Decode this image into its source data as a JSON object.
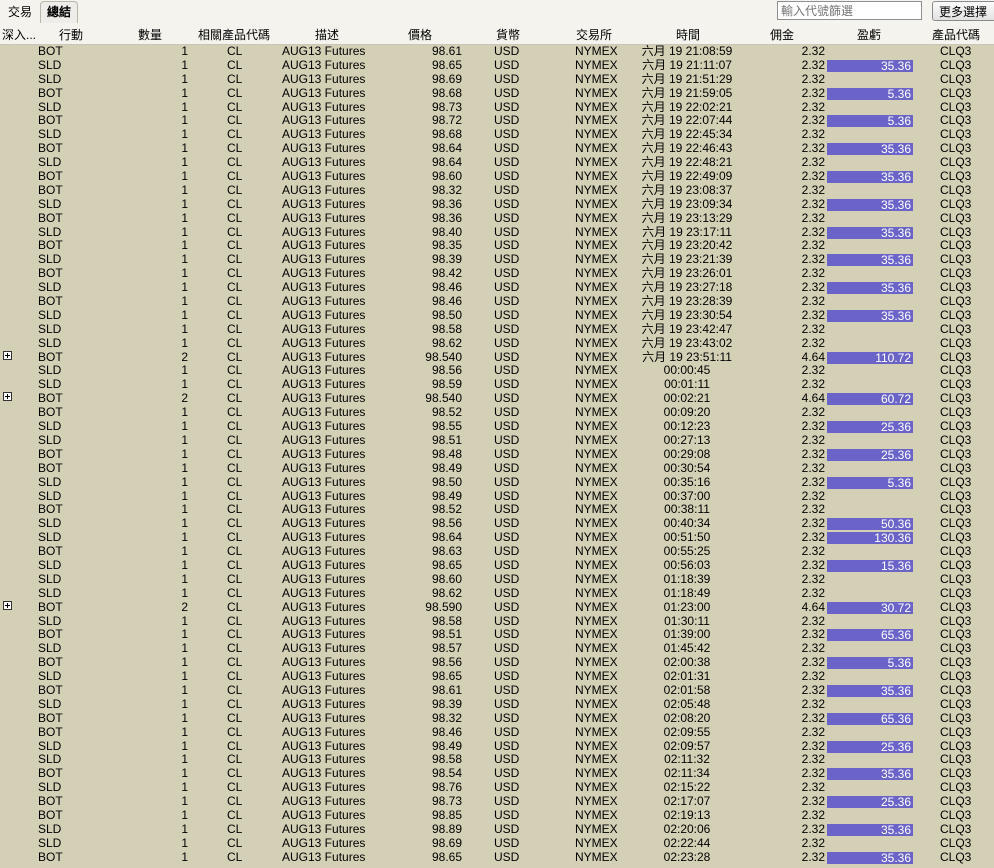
{
  "tabs": [
    {
      "label": "交易"
    },
    {
      "label": "總結"
    }
  ],
  "filter": {
    "placeholder": "輸入代號篩選"
  },
  "more_button": {
    "label": "更多選擇"
  },
  "columns": {
    "drill": "深入...",
    "action": "行動",
    "quantity": "數量",
    "underlying": "相關產品代碼",
    "description": "描述",
    "price": "價格",
    "currency": "貨幣",
    "exchange": "交易所",
    "time": "時間",
    "commission": "佣金",
    "pnl": "盈虧",
    "symbol": "產品代碼"
  },
  "colors": {
    "pnl_bar": "#6b64c8",
    "background": "#d4d0b6"
  },
  "rows": [
    {
      "action": "BOT",
      "qty": "1",
      "und": "CL",
      "desc": "AUG13 Futures",
      "price": "98.61",
      "cur": "USD",
      "exch": "NYMEX",
      "time": "六月 19 21:08:59",
      "comm": "2.32",
      "pnl": "",
      "sym": "CLQ3",
      "expand": false
    },
    {
      "action": "SLD",
      "qty": "1",
      "und": "CL",
      "desc": "AUG13 Futures",
      "price": "98.65",
      "cur": "USD",
      "exch": "NYMEX",
      "time": "六月 19 21:11:07",
      "comm": "2.32",
      "pnl": "35.36",
      "sym": "CLQ3",
      "expand": false
    },
    {
      "action": "SLD",
      "qty": "1",
      "und": "CL",
      "desc": "AUG13 Futures",
      "price": "98.69",
      "cur": "USD",
      "exch": "NYMEX",
      "time": "六月 19 21:51:29",
      "comm": "2.32",
      "pnl": "",
      "sym": "CLQ3",
      "expand": false
    },
    {
      "action": "BOT",
      "qty": "1",
      "und": "CL",
      "desc": "AUG13 Futures",
      "price": "98.68",
      "cur": "USD",
      "exch": "NYMEX",
      "time": "六月 19 21:59:05",
      "comm": "2.32",
      "pnl": "5.36",
      "sym": "CLQ3",
      "expand": false
    },
    {
      "action": "SLD",
      "qty": "1",
      "und": "CL",
      "desc": "AUG13 Futures",
      "price": "98.73",
      "cur": "USD",
      "exch": "NYMEX",
      "time": "六月 19 22:02:21",
      "comm": "2.32",
      "pnl": "",
      "sym": "CLQ3",
      "expand": false
    },
    {
      "action": "BOT",
      "qty": "1",
      "und": "CL",
      "desc": "AUG13 Futures",
      "price": "98.72",
      "cur": "USD",
      "exch": "NYMEX",
      "time": "六月 19 22:07:44",
      "comm": "2.32",
      "pnl": "5.36",
      "sym": "CLQ3",
      "expand": false
    },
    {
      "action": "SLD",
      "qty": "1",
      "und": "CL",
      "desc": "AUG13 Futures",
      "price": "98.68",
      "cur": "USD",
      "exch": "NYMEX",
      "time": "六月 19 22:45:34",
      "comm": "2.32",
      "pnl": "",
      "sym": "CLQ3",
      "expand": false
    },
    {
      "action": "BOT",
      "qty": "1",
      "und": "CL",
      "desc": "AUG13 Futures",
      "price": "98.64",
      "cur": "USD",
      "exch": "NYMEX",
      "time": "六月 19 22:46:43",
      "comm": "2.32",
      "pnl": "35.36",
      "sym": "CLQ3",
      "expand": false
    },
    {
      "action": "SLD",
      "qty": "1",
      "und": "CL",
      "desc": "AUG13 Futures",
      "price": "98.64",
      "cur": "USD",
      "exch": "NYMEX",
      "time": "六月 19 22:48:21",
      "comm": "2.32",
      "pnl": "",
      "sym": "CLQ3",
      "expand": false
    },
    {
      "action": "BOT",
      "qty": "1",
      "und": "CL",
      "desc": "AUG13 Futures",
      "price": "98.60",
      "cur": "USD",
      "exch": "NYMEX",
      "time": "六月 19 22:49:09",
      "comm": "2.32",
      "pnl": "35.36",
      "sym": "CLQ3",
      "expand": false
    },
    {
      "action": "BOT",
      "qty": "1",
      "und": "CL",
      "desc": "AUG13 Futures",
      "price": "98.32",
      "cur": "USD",
      "exch": "NYMEX",
      "time": "六月 19 23:08:37",
      "comm": "2.32",
      "pnl": "",
      "sym": "CLQ3",
      "expand": false
    },
    {
      "action": "SLD",
      "qty": "1",
      "und": "CL",
      "desc": "AUG13 Futures",
      "price": "98.36",
      "cur": "USD",
      "exch": "NYMEX",
      "time": "六月 19 23:09:34",
      "comm": "2.32",
      "pnl": "35.36",
      "sym": "CLQ3",
      "expand": false
    },
    {
      "action": "BOT",
      "qty": "1",
      "und": "CL",
      "desc": "AUG13 Futures",
      "price": "98.36",
      "cur": "USD",
      "exch": "NYMEX",
      "time": "六月 19 23:13:29",
      "comm": "2.32",
      "pnl": "",
      "sym": "CLQ3",
      "expand": false
    },
    {
      "action": "SLD",
      "qty": "1",
      "und": "CL",
      "desc": "AUG13 Futures",
      "price": "98.40",
      "cur": "USD",
      "exch": "NYMEX",
      "time": "六月 19 23:17:11",
      "comm": "2.32",
      "pnl": "35.36",
      "sym": "CLQ3",
      "expand": false
    },
    {
      "action": "BOT",
      "qty": "1",
      "und": "CL",
      "desc": "AUG13 Futures",
      "price": "98.35",
      "cur": "USD",
      "exch": "NYMEX",
      "time": "六月 19 23:20:42",
      "comm": "2.32",
      "pnl": "",
      "sym": "CLQ3",
      "expand": false
    },
    {
      "action": "SLD",
      "qty": "1",
      "und": "CL",
      "desc": "AUG13 Futures",
      "price": "98.39",
      "cur": "USD",
      "exch": "NYMEX",
      "time": "六月 19 23:21:39",
      "comm": "2.32",
      "pnl": "35.36",
      "sym": "CLQ3",
      "expand": false
    },
    {
      "action": "BOT",
      "qty": "1",
      "und": "CL",
      "desc": "AUG13 Futures",
      "price": "98.42",
      "cur": "USD",
      "exch": "NYMEX",
      "time": "六月 19 23:26:01",
      "comm": "2.32",
      "pnl": "",
      "sym": "CLQ3",
      "expand": false
    },
    {
      "action": "SLD",
      "qty": "1",
      "und": "CL",
      "desc": "AUG13 Futures",
      "price": "98.46",
      "cur": "USD",
      "exch": "NYMEX",
      "time": "六月 19 23:27:18",
      "comm": "2.32",
      "pnl": "35.36",
      "sym": "CLQ3",
      "expand": false
    },
    {
      "action": "BOT",
      "qty": "1",
      "und": "CL",
      "desc": "AUG13 Futures",
      "price": "98.46",
      "cur": "USD",
      "exch": "NYMEX",
      "time": "六月 19 23:28:39",
      "comm": "2.32",
      "pnl": "",
      "sym": "CLQ3",
      "expand": false
    },
    {
      "action": "SLD",
      "qty": "1",
      "und": "CL",
      "desc": "AUG13 Futures",
      "price": "98.50",
      "cur": "USD",
      "exch": "NYMEX",
      "time": "六月 19 23:30:54",
      "comm": "2.32",
      "pnl": "35.36",
      "sym": "CLQ3",
      "expand": false
    },
    {
      "action": "SLD",
      "qty": "1",
      "und": "CL",
      "desc": "AUG13 Futures",
      "price": "98.58",
      "cur": "USD",
      "exch": "NYMEX",
      "time": "六月 19 23:42:47",
      "comm": "2.32",
      "pnl": "",
      "sym": "CLQ3",
      "expand": false
    },
    {
      "action": "SLD",
      "qty": "1",
      "und": "CL",
      "desc": "AUG13 Futures",
      "price": "98.62",
      "cur": "USD",
      "exch": "NYMEX",
      "time": "六月 19 23:43:02",
      "comm": "2.32",
      "pnl": "",
      "sym": "CLQ3",
      "expand": false
    },
    {
      "action": "BOT",
      "qty": "2",
      "und": "CL",
      "desc": "AUG13 Futures",
      "price": "98.540",
      "cur": "USD",
      "exch": "NYMEX",
      "time": "六月 19 23:51:11",
      "comm": "4.64",
      "pnl": "110.72",
      "sym": "CLQ3",
      "expand": true
    },
    {
      "action": "SLD",
      "qty": "1",
      "und": "CL",
      "desc": "AUG13 Futures",
      "price": "98.56",
      "cur": "USD",
      "exch": "NYMEX",
      "time": "00:00:45",
      "comm": "2.32",
      "pnl": "",
      "sym": "CLQ3",
      "expand": false
    },
    {
      "action": "SLD",
      "qty": "1",
      "und": "CL",
      "desc": "AUG13 Futures",
      "price": "98.59",
      "cur": "USD",
      "exch": "NYMEX",
      "time": "00:01:11",
      "comm": "2.32",
      "pnl": "",
      "sym": "CLQ3",
      "expand": false
    },
    {
      "action": "BOT",
      "qty": "2",
      "und": "CL",
      "desc": "AUG13 Futures",
      "price": "98.540",
      "cur": "USD",
      "exch": "NYMEX",
      "time": "00:02:21",
      "comm": "4.64",
      "pnl": "60.72",
      "sym": "CLQ3",
      "expand": true
    },
    {
      "action": "BOT",
      "qty": "1",
      "und": "CL",
      "desc": "AUG13 Futures",
      "price": "98.52",
      "cur": "USD",
      "exch": "NYMEX",
      "time": "00:09:20",
      "comm": "2.32",
      "pnl": "",
      "sym": "CLQ3",
      "expand": false
    },
    {
      "action": "SLD",
      "qty": "1",
      "und": "CL",
      "desc": "AUG13 Futures",
      "price": "98.55",
      "cur": "USD",
      "exch": "NYMEX",
      "time": "00:12:23",
      "comm": "2.32",
      "pnl": "25.36",
      "sym": "CLQ3",
      "expand": false
    },
    {
      "action": "SLD",
      "qty": "1",
      "und": "CL",
      "desc": "AUG13 Futures",
      "price": "98.51",
      "cur": "USD",
      "exch": "NYMEX",
      "time": "00:27:13",
      "comm": "2.32",
      "pnl": "",
      "sym": "CLQ3",
      "expand": false
    },
    {
      "action": "BOT",
      "qty": "1",
      "und": "CL",
      "desc": "AUG13 Futures",
      "price": "98.48",
      "cur": "USD",
      "exch": "NYMEX",
      "time": "00:29:08",
      "comm": "2.32",
      "pnl": "25.36",
      "sym": "CLQ3",
      "expand": false
    },
    {
      "action": "BOT",
      "qty": "1",
      "und": "CL",
      "desc": "AUG13 Futures",
      "price": "98.49",
      "cur": "USD",
      "exch": "NYMEX",
      "time": "00:30:54",
      "comm": "2.32",
      "pnl": "",
      "sym": "CLQ3",
      "expand": false
    },
    {
      "action": "SLD",
      "qty": "1",
      "und": "CL",
      "desc": "AUG13 Futures",
      "price": "98.50",
      "cur": "USD",
      "exch": "NYMEX",
      "time": "00:35:16",
      "comm": "2.32",
      "pnl": "5.36",
      "sym": "CLQ3",
      "expand": false
    },
    {
      "action": "SLD",
      "qty": "1",
      "und": "CL",
      "desc": "AUG13 Futures",
      "price": "98.49",
      "cur": "USD",
      "exch": "NYMEX",
      "time": "00:37:00",
      "comm": "2.32",
      "pnl": "",
      "sym": "CLQ3",
      "expand": false
    },
    {
      "action": "BOT",
      "qty": "1",
      "und": "CL",
      "desc": "AUG13 Futures",
      "price": "98.52",
      "cur": "USD",
      "exch": "NYMEX",
      "time": "00:38:11",
      "comm": "2.32",
      "pnl": "",
      "sym": "CLQ3",
      "expand": false
    },
    {
      "action": "SLD",
      "qty": "1",
      "und": "CL",
      "desc": "AUG13 Futures",
      "price": "98.56",
      "cur": "USD",
      "exch": "NYMEX",
      "time": "00:40:34",
      "comm": "2.32",
      "pnl": "50.36",
      "sym": "CLQ3",
      "expand": false
    },
    {
      "action": "SLD",
      "qty": "1",
      "und": "CL",
      "desc": "AUG13 Futures",
      "price": "98.64",
      "cur": "USD",
      "exch": "NYMEX",
      "time": "00:51:50",
      "comm": "2.32",
      "pnl": "130.36",
      "sym": "CLQ3",
      "expand": false
    },
    {
      "action": "BOT",
      "qty": "1",
      "und": "CL",
      "desc": "AUG13 Futures",
      "price": "98.63",
      "cur": "USD",
      "exch": "NYMEX",
      "time": "00:55:25",
      "comm": "2.32",
      "pnl": "",
      "sym": "CLQ3",
      "expand": false
    },
    {
      "action": "SLD",
      "qty": "1",
      "und": "CL",
      "desc": "AUG13 Futures",
      "price": "98.65",
      "cur": "USD",
      "exch": "NYMEX",
      "time": "00:56:03",
      "comm": "2.32",
      "pnl": "15.36",
      "sym": "CLQ3",
      "expand": false
    },
    {
      "action": "SLD",
      "qty": "1",
      "und": "CL",
      "desc": "AUG13 Futures",
      "price": "98.60",
      "cur": "USD",
      "exch": "NYMEX",
      "time": "01:18:39",
      "comm": "2.32",
      "pnl": "",
      "sym": "CLQ3",
      "expand": false
    },
    {
      "action": "SLD",
      "qty": "1",
      "und": "CL",
      "desc": "AUG13 Futures",
      "price": "98.62",
      "cur": "USD",
      "exch": "NYMEX",
      "time": "01:18:49",
      "comm": "2.32",
      "pnl": "",
      "sym": "CLQ3",
      "expand": false
    },
    {
      "action": "BOT",
      "qty": "2",
      "und": "CL",
      "desc": "AUG13 Futures",
      "price": "98.590",
      "cur": "USD",
      "exch": "NYMEX",
      "time": "01:23:00",
      "comm": "4.64",
      "pnl": "30.72",
      "sym": "CLQ3",
      "expand": true
    },
    {
      "action": "SLD",
      "qty": "1",
      "und": "CL",
      "desc": "AUG13 Futures",
      "price": "98.58",
      "cur": "USD",
      "exch": "NYMEX",
      "time": "01:30:11",
      "comm": "2.32",
      "pnl": "",
      "sym": "CLQ3",
      "expand": false
    },
    {
      "action": "BOT",
      "qty": "1",
      "und": "CL",
      "desc": "AUG13 Futures",
      "price": "98.51",
      "cur": "USD",
      "exch": "NYMEX",
      "time": "01:39:00",
      "comm": "2.32",
      "pnl": "65.36",
      "sym": "CLQ3",
      "expand": false
    },
    {
      "action": "SLD",
      "qty": "1",
      "und": "CL",
      "desc": "AUG13 Futures",
      "price": "98.57",
      "cur": "USD",
      "exch": "NYMEX",
      "time": "01:45:42",
      "comm": "2.32",
      "pnl": "",
      "sym": "CLQ3",
      "expand": false
    },
    {
      "action": "BOT",
      "qty": "1",
      "und": "CL",
      "desc": "AUG13 Futures",
      "price": "98.56",
      "cur": "USD",
      "exch": "NYMEX",
      "time": "02:00:38",
      "comm": "2.32",
      "pnl": "5.36",
      "sym": "CLQ3",
      "expand": false
    },
    {
      "action": "SLD",
      "qty": "1",
      "und": "CL",
      "desc": "AUG13 Futures",
      "price": "98.65",
      "cur": "USD",
      "exch": "NYMEX",
      "time": "02:01:31",
      "comm": "2.32",
      "pnl": "",
      "sym": "CLQ3",
      "expand": false
    },
    {
      "action": "BOT",
      "qty": "1",
      "und": "CL",
      "desc": "AUG13 Futures",
      "price": "98.61",
      "cur": "USD",
      "exch": "NYMEX",
      "time": "02:01:58",
      "comm": "2.32",
      "pnl": "35.36",
      "sym": "CLQ3",
      "expand": false
    },
    {
      "action": "SLD",
      "qty": "1",
      "und": "CL",
      "desc": "AUG13 Futures",
      "price": "98.39",
      "cur": "USD",
      "exch": "NYMEX",
      "time": "02:05:48",
      "comm": "2.32",
      "pnl": "",
      "sym": "CLQ3",
      "expand": false
    },
    {
      "action": "BOT",
      "qty": "1",
      "und": "CL",
      "desc": "AUG13 Futures",
      "price": "98.32",
      "cur": "USD",
      "exch": "NYMEX",
      "time": "02:08:20",
      "comm": "2.32",
      "pnl": "65.36",
      "sym": "CLQ3",
      "expand": false
    },
    {
      "action": "BOT",
      "qty": "1",
      "und": "CL",
      "desc": "AUG13 Futures",
      "price": "98.46",
      "cur": "USD",
      "exch": "NYMEX",
      "time": "02:09:55",
      "comm": "2.32",
      "pnl": "",
      "sym": "CLQ3",
      "expand": false
    },
    {
      "action": "SLD",
      "qty": "1",
      "und": "CL",
      "desc": "AUG13 Futures",
      "price": "98.49",
      "cur": "USD",
      "exch": "NYMEX",
      "time": "02:09:57",
      "comm": "2.32",
      "pnl": "25.36",
      "sym": "CLQ3",
      "expand": false
    },
    {
      "action": "SLD",
      "qty": "1",
      "und": "CL",
      "desc": "AUG13 Futures",
      "price": "98.58",
      "cur": "USD",
      "exch": "NYMEX",
      "time": "02:11:32",
      "comm": "2.32",
      "pnl": "",
      "sym": "CLQ3",
      "expand": false
    },
    {
      "action": "BOT",
      "qty": "1",
      "und": "CL",
      "desc": "AUG13 Futures",
      "price": "98.54",
      "cur": "USD",
      "exch": "NYMEX",
      "time": "02:11:34",
      "comm": "2.32",
      "pnl": "35.36",
      "sym": "CLQ3",
      "expand": false
    },
    {
      "action": "SLD",
      "qty": "1",
      "und": "CL",
      "desc": "AUG13 Futures",
      "price": "98.76",
      "cur": "USD",
      "exch": "NYMEX",
      "time": "02:15:22",
      "comm": "2.32",
      "pnl": "",
      "sym": "CLQ3",
      "expand": false
    },
    {
      "action": "BOT",
      "qty": "1",
      "und": "CL",
      "desc": "AUG13 Futures",
      "price": "98.73",
      "cur": "USD",
      "exch": "NYMEX",
      "time": "02:17:07",
      "comm": "2.32",
      "pnl": "25.36",
      "sym": "CLQ3",
      "expand": false
    },
    {
      "action": "BOT",
      "qty": "1",
      "und": "CL",
      "desc": "AUG13 Futures",
      "price": "98.85",
      "cur": "USD",
      "exch": "NYMEX",
      "time": "02:19:13",
      "comm": "2.32",
      "pnl": "",
      "sym": "CLQ3",
      "expand": false
    },
    {
      "action": "SLD",
      "qty": "1",
      "und": "CL",
      "desc": "AUG13 Futures",
      "price": "98.89",
      "cur": "USD",
      "exch": "NYMEX",
      "time": "02:20:06",
      "comm": "2.32",
      "pnl": "35.36",
      "sym": "CLQ3",
      "expand": false
    },
    {
      "action": "SLD",
      "qty": "1",
      "und": "CL",
      "desc": "AUG13 Futures",
      "price": "98.69",
      "cur": "USD",
      "exch": "NYMEX",
      "time": "02:22:44",
      "comm": "2.32",
      "pnl": "",
      "sym": "CLQ3",
      "expand": false
    },
    {
      "action": "BOT",
      "qty": "1",
      "und": "CL",
      "desc": "AUG13 Futures",
      "price": "98.65",
      "cur": "USD",
      "exch": "NYMEX",
      "time": "02:23:28",
      "comm": "2.32",
      "pnl": "35.36",
      "sym": "CLQ3",
      "expand": false
    }
  ]
}
